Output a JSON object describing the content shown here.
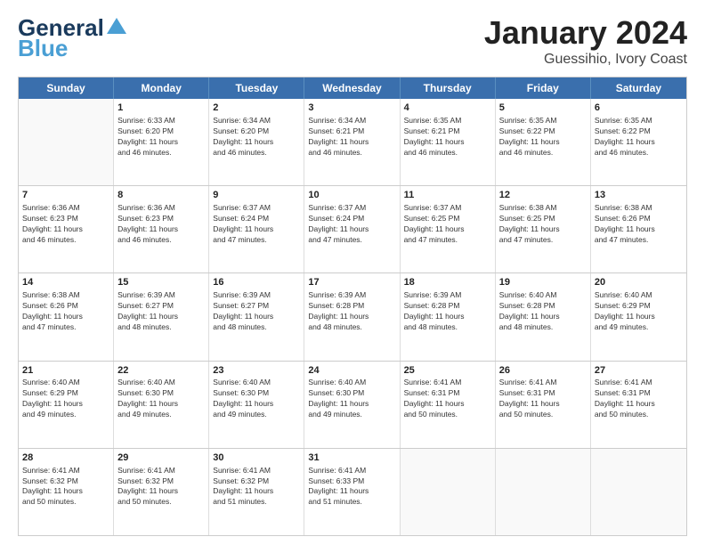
{
  "header": {
    "logo_general": "General",
    "logo_blue": "Blue",
    "title": "January 2024",
    "subtitle": "Guessihio, Ivory Coast"
  },
  "calendar": {
    "days": [
      "Sunday",
      "Monday",
      "Tuesday",
      "Wednesday",
      "Thursday",
      "Friday",
      "Saturday"
    ],
    "rows": [
      [
        {
          "num": "",
          "lines": []
        },
        {
          "num": "1",
          "lines": [
            "Sunrise: 6:33 AM",
            "Sunset: 6:20 PM",
            "Daylight: 11 hours",
            "and 46 minutes."
          ]
        },
        {
          "num": "2",
          "lines": [
            "Sunrise: 6:34 AM",
            "Sunset: 6:20 PM",
            "Daylight: 11 hours",
            "and 46 minutes."
          ]
        },
        {
          "num": "3",
          "lines": [
            "Sunrise: 6:34 AM",
            "Sunset: 6:21 PM",
            "Daylight: 11 hours",
            "and 46 minutes."
          ]
        },
        {
          "num": "4",
          "lines": [
            "Sunrise: 6:35 AM",
            "Sunset: 6:21 PM",
            "Daylight: 11 hours",
            "and 46 minutes."
          ]
        },
        {
          "num": "5",
          "lines": [
            "Sunrise: 6:35 AM",
            "Sunset: 6:22 PM",
            "Daylight: 11 hours",
            "and 46 minutes."
          ]
        },
        {
          "num": "6",
          "lines": [
            "Sunrise: 6:35 AM",
            "Sunset: 6:22 PM",
            "Daylight: 11 hours",
            "and 46 minutes."
          ]
        }
      ],
      [
        {
          "num": "7",
          "lines": [
            "Sunrise: 6:36 AM",
            "Sunset: 6:23 PM",
            "Daylight: 11 hours",
            "and 46 minutes."
          ]
        },
        {
          "num": "8",
          "lines": [
            "Sunrise: 6:36 AM",
            "Sunset: 6:23 PM",
            "Daylight: 11 hours",
            "and 46 minutes."
          ]
        },
        {
          "num": "9",
          "lines": [
            "Sunrise: 6:37 AM",
            "Sunset: 6:24 PM",
            "Daylight: 11 hours",
            "and 47 minutes."
          ]
        },
        {
          "num": "10",
          "lines": [
            "Sunrise: 6:37 AM",
            "Sunset: 6:24 PM",
            "Daylight: 11 hours",
            "and 47 minutes."
          ]
        },
        {
          "num": "11",
          "lines": [
            "Sunrise: 6:37 AM",
            "Sunset: 6:25 PM",
            "Daylight: 11 hours",
            "and 47 minutes."
          ]
        },
        {
          "num": "12",
          "lines": [
            "Sunrise: 6:38 AM",
            "Sunset: 6:25 PM",
            "Daylight: 11 hours",
            "and 47 minutes."
          ]
        },
        {
          "num": "13",
          "lines": [
            "Sunrise: 6:38 AM",
            "Sunset: 6:26 PM",
            "Daylight: 11 hours",
            "and 47 minutes."
          ]
        }
      ],
      [
        {
          "num": "14",
          "lines": [
            "Sunrise: 6:38 AM",
            "Sunset: 6:26 PM",
            "Daylight: 11 hours",
            "and 47 minutes."
          ]
        },
        {
          "num": "15",
          "lines": [
            "Sunrise: 6:39 AM",
            "Sunset: 6:27 PM",
            "Daylight: 11 hours",
            "and 48 minutes."
          ]
        },
        {
          "num": "16",
          "lines": [
            "Sunrise: 6:39 AM",
            "Sunset: 6:27 PM",
            "Daylight: 11 hours",
            "and 48 minutes."
          ]
        },
        {
          "num": "17",
          "lines": [
            "Sunrise: 6:39 AM",
            "Sunset: 6:28 PM",
            "Daylight: 11 hours",
            "and 48 minutes."
          ]
        },
        {
          "num": "18",
          "lines": [
            "Sunrise: 6:39 AM",
            "Sunset: 6:28 PM",
            "Daylight: 11 hours",
            "and 48 minutes."
          ]
        },
        {
          "num": "19",
          "lines": [
            "Sunrise: 6:40 AM",
            "Sunset: 6:28 PM",
            "Daylight: 11 hours",
            "and 48 minutes."
          ]
        },
        {
          "num": "20",
          "lines": [
            "Sunrise: 6:40 AM",
            "Sunset: 6:29 PM",
            "Daylight: 11 hours",
            "and 49 minutes."
          ]
        }
      ],
      [
        {
          "num": "21",
          "lines": [
            "Sunrise: 6:40 AM",
            "Sunset: 6:29 PM",
            "Daylight: 11 hours",
            "and 49 minutes."
          ]
        },
        {
          "num": "22",
          "lines": [
            "Sunrise: 6:40 AM",
            "Sunset: 6:30 PM",
            "Daylight: 11 hours",
            "and 49 minutes."
          ]
        },
        {
          "num": "23",
          "lines": [
            "Sunrise: 6:40 AM",
            "Sunset: 6:30 PM",
            "Daylight: 11 hours",
            "and 49 minutes."
          ]
        },
        {
          "num": "24",
          "lines": [
            "Sunrise: 6:40 AM",
            "Sunset: 6:30 PM",
            "Daylight: 11 hours",
            "and 49 minutes."
          ]
        },
        {
          "num": "25",
          "lines": [
            "Sunrise: 6:41 AM",
            "Sunset: 6:31 PM",
            "Daylight: 11 hours",
            "and 50 minutes."
          ]
        },
        {
          "num": "26",
          "lines": [
            "Sunrise: 6:41 AM",
            "Sunset: 6:31 PM",
            "Daylight: 11 hours",
            "and 50 minutes."
          ]
        },
        {
          "num": "27",
          "lines": [
            "Sunrise: 6:41 AM",
            "Sunset: 6:31 PM",
            "Daylight: 11 hours",
            "and 50 minutes."
          ]
        }
      ],
      [
        {
          "num": "28",
          "lines": [
            "Sunrise: 6:41 AM",
            "Sunset: 6:32 PM",
            "Daylight: 11 hours",
            "and 50 minutes."
          ]
        },
        {
          "num": "29",
          "lines": [
            "Sunrise: 6:41 AM",
            "Sunset: 6:32 PM",
            "Daylight: 11 hours",
            "and 50 minutes."
          ]
        },
        {
          "num": "30",
          "lines": [
            "Sunrise: 6:41 AM",
            "Sunset: 6:32 PM",
            "Daylight: 11 hours",
            "and 51 minutes."
          ]
        },
        {
          "num": "31",
          "lines": [
            "Sunrise: 6:41 AM",
            "Sunset: 6:33 PM",
            "Daylight: 11 hours",
            "and 51 minutes."
          ]
        },
        {
          "num": "",
          "lines": []
        },
        {
          "num": "",
          "lines": []
        },
        {
          "num": "",
          "lines": []
        }
      ]
    ]
  }
}
